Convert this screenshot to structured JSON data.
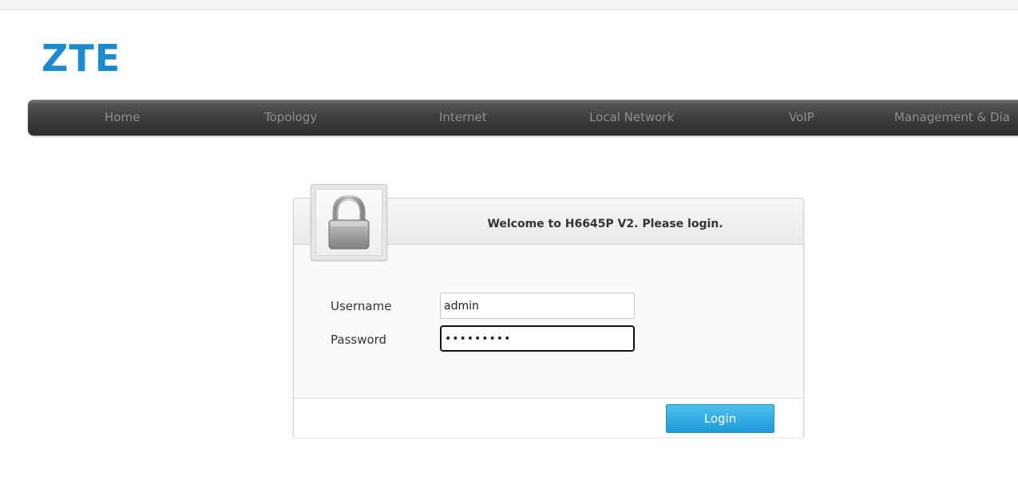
{
  "logo": {
    "text": "ZTE",
    "color": "#1b8bd1"
  },
  "nav": {
    "items": [
      "Home",
      "Topology",
      "Internet",
      "Local Network",
      "VoIP",
      "Management & Dia"
    ]
  },
  "login": {
    "lock_icon": "padlock-icon",
    "welcome": "Welcome to H6645P V2. Please login.",
    "username_label": "Username",
    "username_value": "admin",
    "password_label": "Password",
    "password_value": "•••••••••",
    "button_label": "Login",
    "button_color": "#2aa6e0"
  }
}
